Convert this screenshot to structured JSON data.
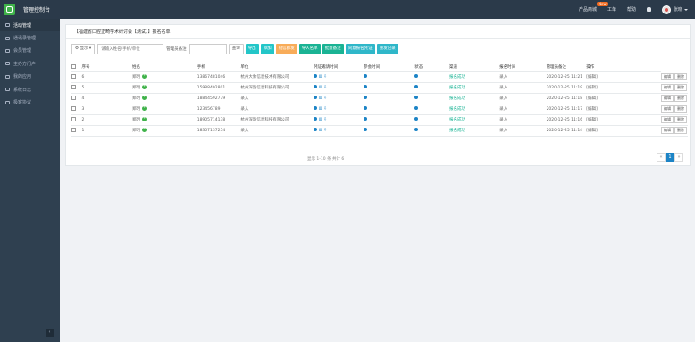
{
  "header": {
    "app_title": "管理控制台",
    "links": [
      {
        "label": "产品商城",
        "badge": "New"
      },
      {
        "label": "工单"
      },
      {
        "label": "帮助"
      }
    ],
    "user_name": "张晓"
  },
  "sidebar": {
    "items": [
      {
        "label": "活动管理",
        "active": true
      },
      {
        "label": "通讯录管理"
      },
      {
        "label": "会员管理"
      },
      {
        "label": "主办方门户"
      },
      {
        "label": "我的应用"
      },
      {
        "label": "系统日志"
      },
      {
        "label": "极客协议"
      }
    ],
    "collapse": "‹"
  },
  "panel": {
    "title": "【福建省口腔正畸学术研讨会【测试】】报名名单",
    "toolbar": {
      "display_select": "显示",
      "search_placeholder": "请输入姓名/手机/单位",
      "admin_note_label": "管理员备注",
      "query": "查询",
      "buttons": [
        "导出",
        "添加",
        "短信群发",
        "导入名单",
        "批量备注",
        "同意报名凭证",
        "重发记录"
      ]
    },
    "columns": [
      "序号",
      "姓名",
      "手机",
      "单位",
      "凭证邀请时间",
      "参会时间",
      "状态",
      "渠道",
      "报名时间",
      "管理员备注",
      "操作"
    ],
    "rows": [
      {
        "no": "6",
        "name": "郑明",
        "phone": "13867481046",
        "unit": "杭州大象信息技术有限公司",
        "status": "报名成功",
        "channel": "录入",
        "time": "2020-12-25 11:21",
        "note": "[编辑]"
      },
      {
        "no": "5",
        "name": "郑明",
        "phone": "15988402801",
        "unit": "杭州深韵信息科技有限公司",
        "status": "报名成功",
        "channel": "录入",
        "time": "2020-12-25 11:19",
        "note": "[编辑]"
      },
      {
        "no": "4",
        "name": "郑明",
        "phone": "18844592779",
        "unit": "录入",
        "status": "报名成功",
        "channel": "录入",
        "time": "2020-12-25 11:18",
        "note": "[编辑]"
      },
      {
        "no": "3",
        "name": "郑明",
        "phone": "123456789",
        "unit": "录入",
        "status": "报名成功",
        "channel": "录入",
        "time": "2020-12-25 11:17",
        "note": "[编辑]"
      },
      {
        "no": "2",
        "name": "郑明",
        "phone": "18905714138",
        "unit": "杭州深韵信息科技有限公司",
        "status": "报名成功",
        "channel": "录入",
        "time": "2020-12-25 11:16",
        "note": "[编辑]"
      },
      {
        "no": "1",
        "name": "郑明",
        "phone": "18357137254",
        "unit": "录入",
        "status": "报名成功",
        "channel": "录入",
        "time": "2020-12-25 11:14",
        "note": "[编辑]"
      }
    ],
    "row_actions": [
      "编辑",
      "删除"
    ],
    "footer_info": "显示 1-10 条 共计 6",
    "pager": [
      "«",
      "1",
      "»"
    ]
  }
}
